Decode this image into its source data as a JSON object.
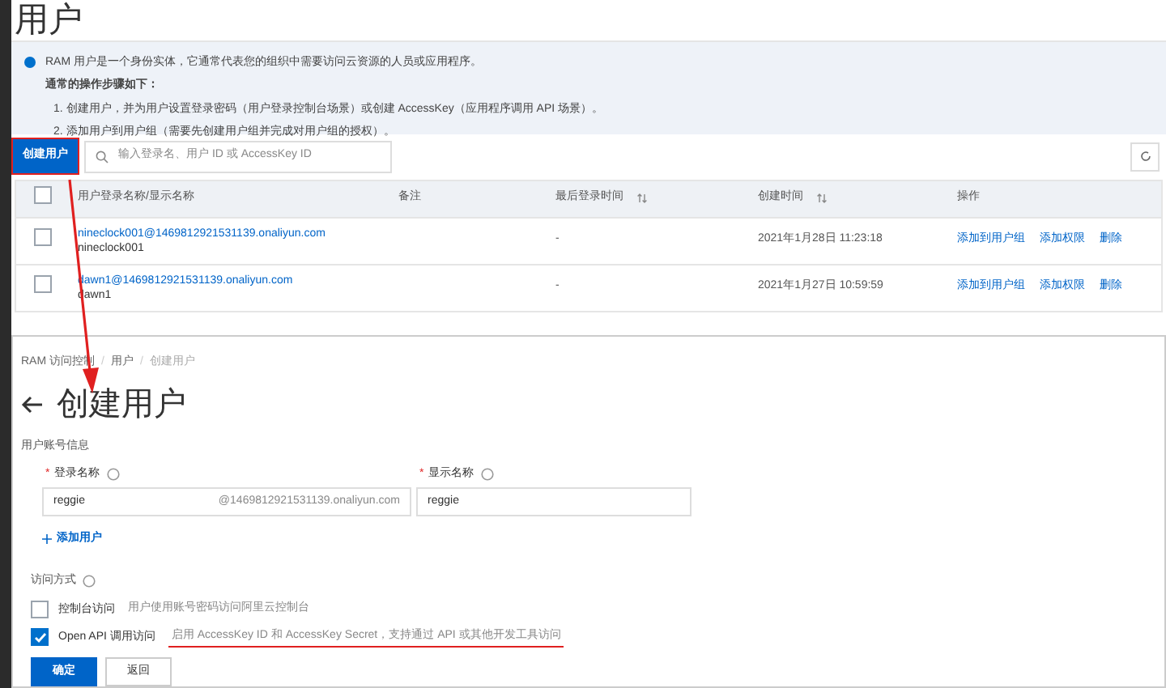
{
  "page_title": "用户",
  "info": {
    "intro": "RAM 用户是一个身份实体，它通常代表您的组织中需要访问云资源的人员或应用程序。",
    "steps_title": "通常的操作步骤如下：",
    "steps": [
      "1. 创建用户，并为用户设置登录密码（用户登录控制台场景）或创建 AccessKey（应用程序调用 API 场景）。",
      "2. 添加用户到用户组（需要先创建用户组并完成对用户组的授权）。"
    ]
  },
  "create_button": {
    "label": "创建用户",
    "annotated": true
  },
  "search": {
    "placeholder": "输入登录名、用户 ID 或 AccessKey ID"
  },
  "table": {
    "all_checked": false,
    "columns": [
      {
        "label": "用户登录名称/显示名称",
        "sortable": false
      },
      {
        "label": "备注",
        "sortable": false
      },
      {
        "label": "最后登录时间",
        "sortable": true
      },
      {
        "label": "创建时间",
        "sortable": true
      },
      {
        "label": "操作",
        "sortable": false
      }
    ],
    "rows": [
      {
        "checked": false,
        "login": "nineclock001@1469812921531139.onaliyun.com",
        "display": "nineclock001",
        "note": "",
        "last_login": "-",
        "created": "2021年1月28日 11:23:18",
        "actions": [
          "添加到用户组",
          "添加权限",
          "删除"
        ]
      },
      {
        "checked": false,
        "login": "dawn1@1469812921531139.onaliyun.com",
        "display": "dawn1",
        "note": "",
        "last_login": "-",
        "created": "2021年1月27日 10:59:59",
        "actions": [
          "添加到用户组",
          "添加权限",
          "删除"
        ]
      }
    ]
  },
  "create_panel": {
    "breadcrumb": [
      {
        "label": "RAM 访问控制",
        "current": false
      },
      {
        "label": "用户",
        "current": false
      },
      {
        "label": "创建用户",
        "current": true
      }
    ],
    "breadcrumb_separator": "/",
    "title": "创建用户",
    "section": "用户账号信息",
    "login_field": {
      "label": "登录名称",
      "required_mark": "*",
      "value": "reggie",
      "suffix": "@1469812921531139.onaliyun.com"
    },
    "display_field": {
      "label": "显示名称",
      "required_mark": "*",
      "value": "reggie"
    },
    "add_user": "添加用户",
    "access_label": "访问方式",
    "access_options": [
      {
        "label": "控制台访问",
        "description": "用户使用账号密码访问阿里云控制台",
        "checked": false,
        "underlined": false
      },
      {
        "label": "Open API 调用访问",
        "description": "启用 AccessKey ID 和 AccessKey Secret，支持通过 API 或其他开发工具访问",
        "checked": true,
        "underlined": true
      }
    ],
    "buttons": [
      {
        "label": "确定",
        "kind": "primary"
      },
      {
        "label": "返回",
        "kind": "secondary"
      }
    ]
  }
}
